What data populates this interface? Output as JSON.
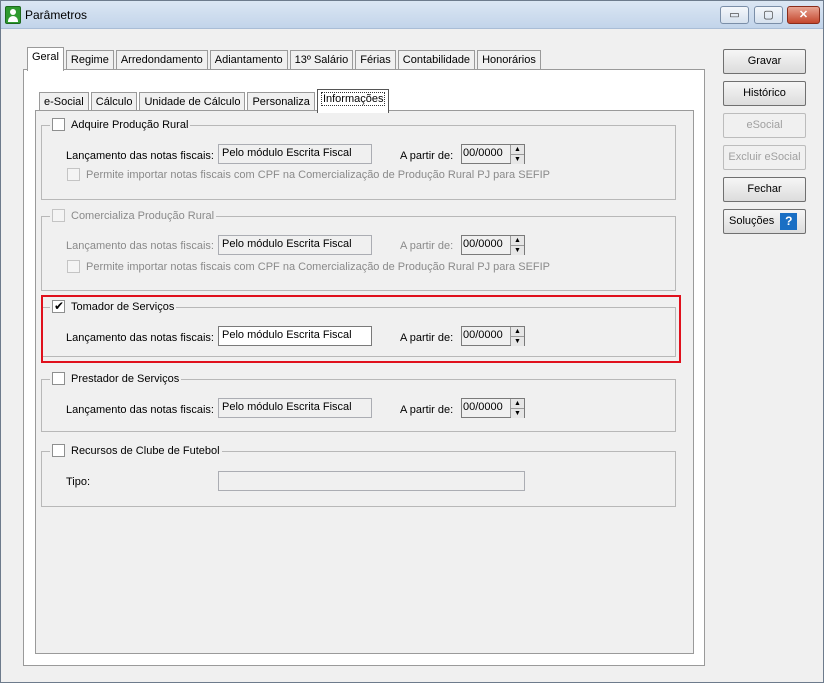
{
  "window": {
    "title": "Parâmetros",
    "min_label": "▭",
    "max_label": "▢",
    "close_label": "✕"
  },
  "outer_tabs": [
    "Geral",
    "Regime",
    "Arredondamento",
    "Adiantamento",
    "13º Salário",
    "Férias",
    "Contabilidade",
    "Honorários"
  ],
  "outer_active": "Geral",
  "inner_tabs": [
    "e-Social",
    "Cálculo",
    "Unidade de Cálculo",
    "Personaliza",
    "Informações"
  ],
  "inner_active": "Informações",
  "groups": {
    "produtor_rural": {
      "title": "Adquire Produção Rural",
      "checked": false,
      "lancamento_label": "Lançamento das notas fiscais:",
      "lancamento_value": "Pelo módulo Escrita Fiscal",
      "partir_label": "A partir de:",
      "partir_value": "00/0000",
      "permite_label": "Permite importar notas fiscais com CPF na Comercialização de Produção Rural PJ para SEFIP"
    },
    "comercializa": {
      "title": "Comercializa Produção Rural",
      "checked": false,
      "lancamento_label": "Lançamento das notas fiscais:",
      "lancamento_value": "Pelo módulo Escrita Fiscal",
      "partir_label": "A partir de:",
      "partir_value": "00/0000",
      "permite_label": "Permite importar notas fiscais com CPF na Comercialização de Produção Rural PJ para SEFIP"
    },
    "tomador": {
      "title": "Tomador de Serviços",
      "checked": true,
      "lancamento_label": "Lançamento das notas fiscais:",
      "lancamento_value": "Pelo módulo Escrita Fiscal",
      "partir_label": "A partir de:",
      "partir_value": "00/0000"
    },
    "prestador": {
      "title": "Prestador de Serviços",
      "checked": false,
      "lancamento_label": "Lançamento das notas fiscais:",
      "lancamento_value": "Pelo módulo Escrita Fiscal",
      "partir_label": "A partir de:",
      "partir_value": "00/0000"
    },
    "clube": {
      "title": "Recursos de Clube de Futebol",
      "checked": false,
      "tipo_label": "Tipo:",
      "tipo_value": ""
    }
  },
  "buttons": {
    "gravar": "Gravar",
    "historico": "Histórico",
    "esocial": "eSocial",
    "excluir_esocial": "Excluir eSocial",
    "fechar": "Fechar",
    "solucoes": "Soluções",
    "help_glyph": "?"
  },
  "colors": {
    "highlight": "#e0101c",
    "help_icon": "#1a6fc4"
  }
}
